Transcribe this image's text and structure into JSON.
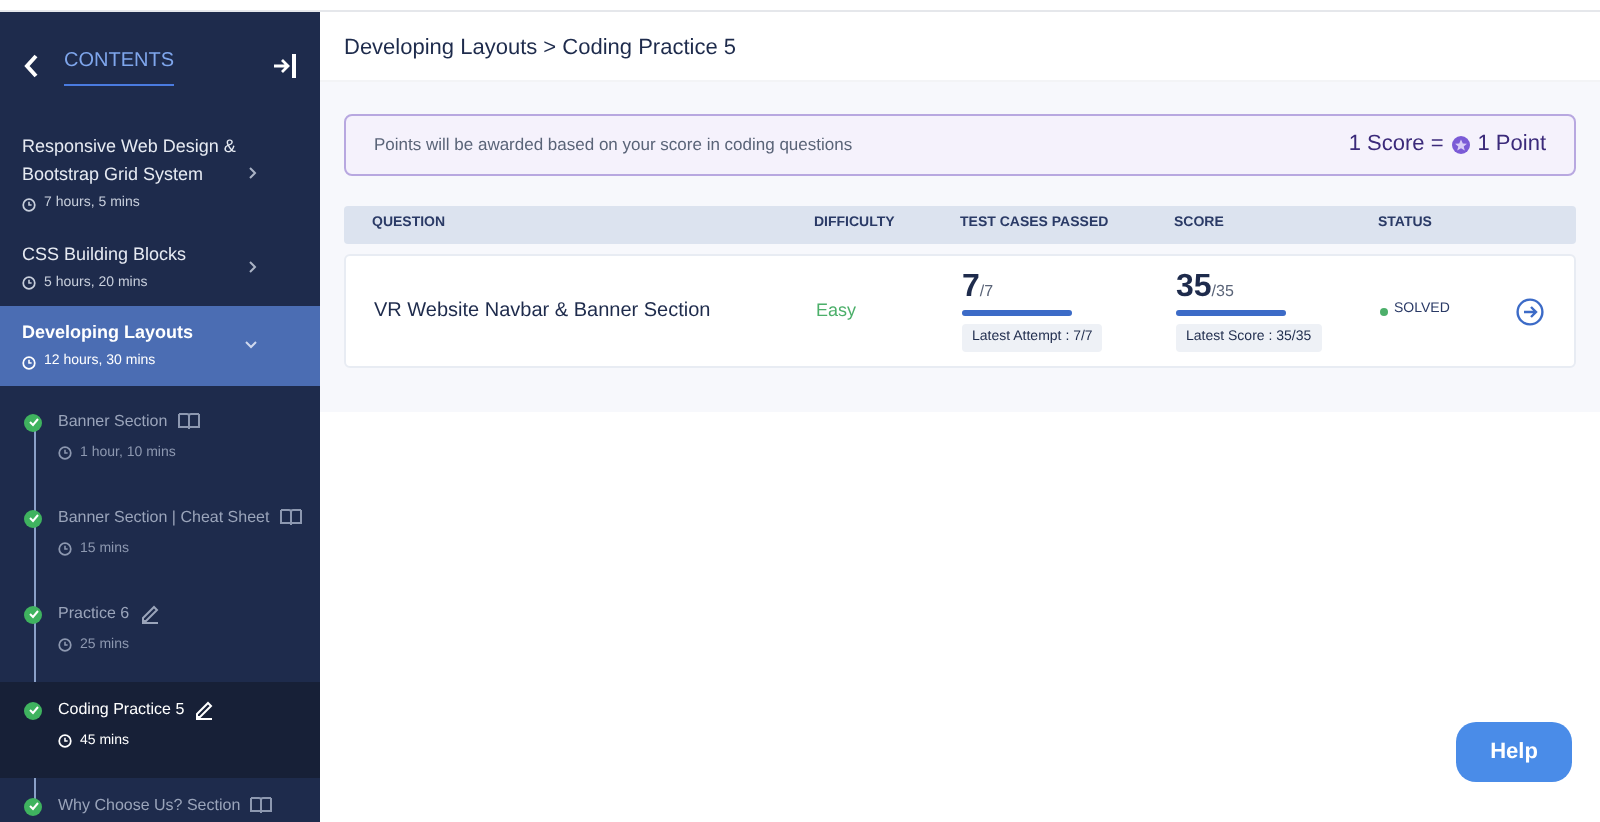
{
  "sidebar": {
    "title": "CONTENTS",
    "modules": [
      {
        "title": "Responsive Web Design & Bootstrap Grid System",
        "duration": "7 hours, 5 mins",
        "expanded": false,
        "selected": false
      },
      {
        "title": "CSS Building Blocks",
        "duration": "5 hours, 20 mins",
        "expanded": false,
        "selected": false
      },
      {
        "title": "Developing Layouts",
        "duration": "12 hours, 30 mins",
        "expanded": true,
        "selected": true
      }
    ],
    "lessons": [
      {
        "title": "Banner Section",
        "duration": "1 hour, 10 mins",
        "kind": "reading",
        "completed": true,
        "selected": false
      },
      {
        "title": "Banner Section | Cheat Sheet",
        "duration": "15 mins",
        "kind": "reading",
        "completed": true,
        "selected": false
      },
      {
        "title": "Practice 6",
        "duration": "25 mins",
        "kind": "practice",
        "completed": true,
        "selected": false
      },
      {
        "title": "Coding Practice 5",
        "duration": "45 mins",
        "kind": "practice",
        "completed": true,
        "selected": true
      },
      {
        "title": "Why Choose Us? Section",
        "kind": "reading",
        "completed": true,
        "selected": false
      }
    ]
  },
  "breadcrumb": "Developing Layouts > Coding Practice 5",
  "points_banner": {
    "text": "Points will be awarded based on your score in coding questions",
    "score_label": "1 Score =",
    "point_label": "1 Point"
  },
  "table": {
    "columns": [
      "QUESTION",
      "DIFFICULTY",
      "TEST CASES PASSED",
      "SCORE",
      "STATUS"
    ],
    "rows": [
      {
        "question": "VR Website Navbar & Banner Section",
        "difficulty": "Easy",
        "test_cases": {
          "value": "7",
          "total": "/7",
          "level": 1,
          "note": "Latest Attempt : 7/7"
        },
        "score": {
          "value": "35",
          "total": "/35",
          "level": 1,
          "note": "Latest Score : 35/35"
        },
        "status": "SOLVED"
      }
    ]
  },
  "help_button": "Help"
}
